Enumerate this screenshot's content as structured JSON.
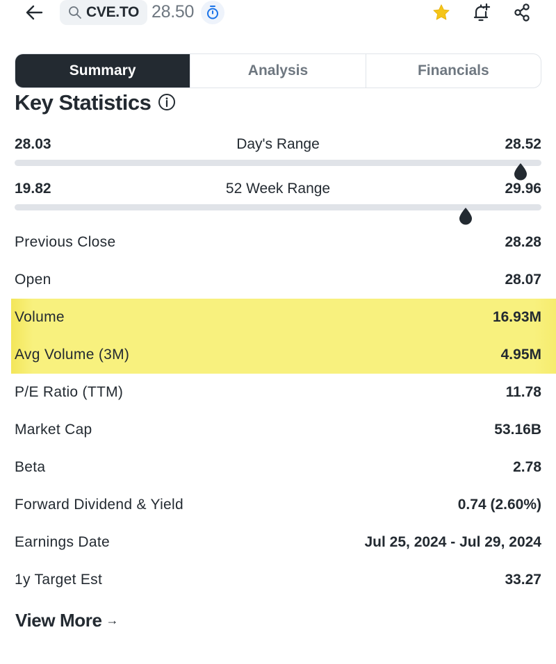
{
  "header": {
    "back_icon": "arrow-left-icon",
    "search_icon": "search-icon",
    "ticker": "CVE.TO",
    "price": "28.50",
    "market_status_icon": "stopwatch-icon",
    "watchlist_icon": "star-icon",
    "alert_icon": "bell-plus-icon",
    "share_icon": "share-icon"
  },
  "tabs": [
    {
      "label": "Summary",
      "active": true
    },
    {
      "label": "Analysis",
      "active": false
    },
    {
      "label": "Financials",
      "active": false
    }
  ],
  "section": {
    "title": "Key Statistics",
    "info_icon": "info-icon"
  },
  "ranges": [
    {
      "label": "Day's Range",
      "low": "28.03",
      "high": "28.52",
      "current_pct": 96
    },
    {
      "label": "52 Week Range",
      "low": "19.82",
      "high": "29.96",
      "current_pct": 85.6
    }
  ],
  "stats": [
    {
      "label": "Previous Close",
      "value": "28.28",
      "highlighted": false
    },
    {
      "label": "Open",
      "value": "28.07",
      "highlighted": false
    },
    {
      "label": "Volume",
      "value": "16.93M",
      "highlighted": true
    },
    {
      "label": "Avg Volume (3M)",
      "value": "4.95M",
      "highlighted": true
    },
    {
      "label": "P/E Ratio (TTM)",
      "value": "11.78",
      "highlighted": false
    },
    {
      "label": "Market Cap",
      "value": "53.16B",
      "highlighted": false
    },
    {
      "label": "Beta",
      "value": "2.78",
      "highlighted": false
    },
    {
      "label": "Forward Dividend & Yield",
      "value": "0.74 (2.60%)",
      "highlighted": false
    },
    {
      "label": "Earnings Date",
      "value": "Jul 25, 2024 - Jul 29, 2024",
      "highlighted": false
    },
    {
      "label": "1y Target Est",
      "value": "33.27",
      "highlighted": false
    }
  ],
  "view_more": {
    "label": "View More",
    "arrow": "→"
  },
  "colors": {
    "active_tab_bg": "#232a31",
    "highlight": "#f8f17e",
    "star": "#f5c518",
    "track": "#e0e3e8",
    "accent_blue": "#1a73e8"
  }
}
